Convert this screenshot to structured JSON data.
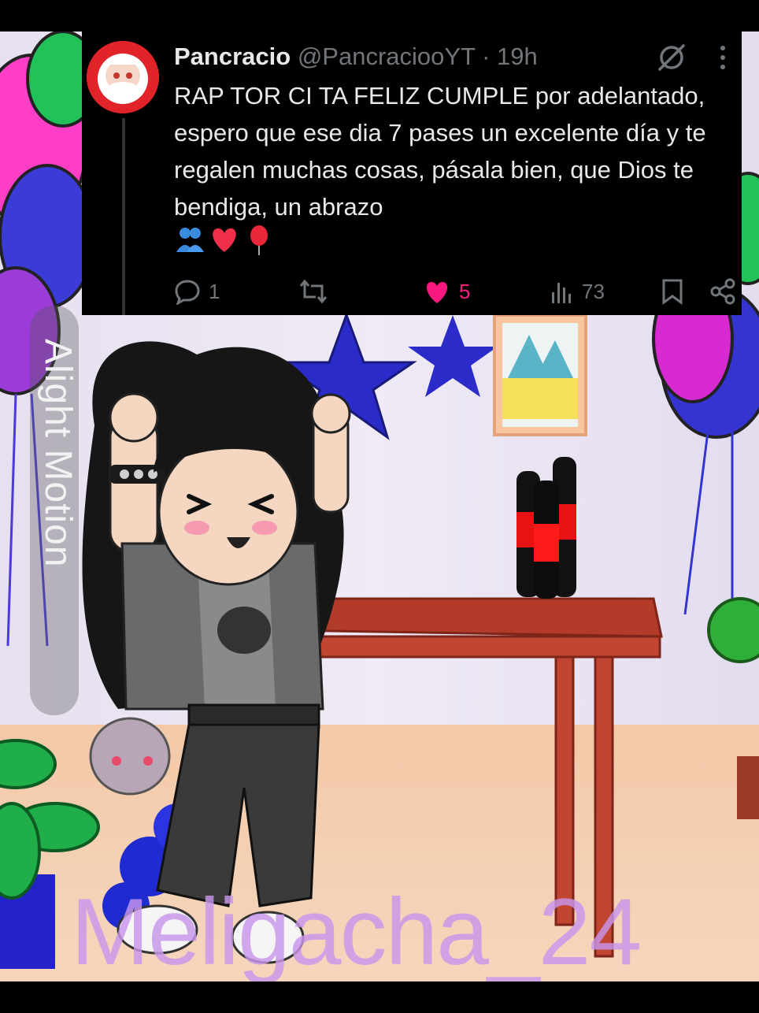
{
  "tweet": {
    "author_name": "Pancracio",
    "author_handle": "@PancraciooYT",
    "separator": " · ",
    "time_ago": "19h",
    "text": "RAP TOR CI TA FELIZ CUMPLE por adelantado, espero que ese dia 7 pases un excelente día y te regalen muchas cosas, pásala bien, que Dios te bendiga, un abrazo",
    "emojis": [
      "people-hugging-emoji",
      "red-heart-emoji",
      "balloon-emoji"
    ],
    "reply_count": "1",
    "retweet_count": "",
    "like_count": "5",
    "view_count": "73",
    "colors": {
      "like": "#f91880",
      "muted": "#71767b",
      "text": "#e7e9ea",
      "background": "#000000"
    }
  },
  "watermark": {
    "app": "Alight Motion",
    "signature": "Meligacha_24"
  },
  "scene": {
    "description_icons": [
      "stars",
      "balloons",
      "table",
      "bottles",
      "picture-frame",
      "plants",
      "character"
    ]
  }
}
